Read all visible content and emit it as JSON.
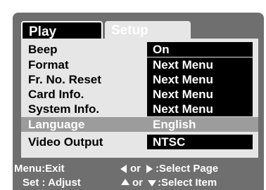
{
  "tabs": [
    {
      "label": "Play",
      "active": false
    },
    {
      "label": "Setup",
      "active": true
    }
  ],
  "menu": {
    "items": [
      {
        "label": "Beep",
        "value": "On"
      },
      {
        "label": "Format",
        "value": "Next Menu"
      },
      {
        "label": "Fr. No. Reset",
        "value": "Next Menu"
      },
      {
        "label": "Card Info.",
        "value": "Next Menu"
      },
      {
        "label": "System Info.",
        "value": "Next Menu"
      },
      {
        "label": "Language",
        "value": "English",
        "selected": true
      },
      {
        "label": "Video Output",
        "value": "NTSC"
      }
    ]
  },
  "footer": {
    "menu_hint": "Menu:Exit",
    "set_hint": "Set : Adjust",
    "or_text": "or",
    "select_page": ":Select Page",
    "select_item": ":Select Item"
  },
  "colors": {
    "panel_background": "#e6e6e6",
    "screen_background": "#6f6f6f",
    "highlight": "#9c9c9c",
    "value_background": "#000000"
  },
  "icons": {
    "left": "triangle-left-icon",
    "right": "triangle-right-icon",
    "up": "triangle-up-icon",
    "down": "triangle-down-icon"
  }
}
